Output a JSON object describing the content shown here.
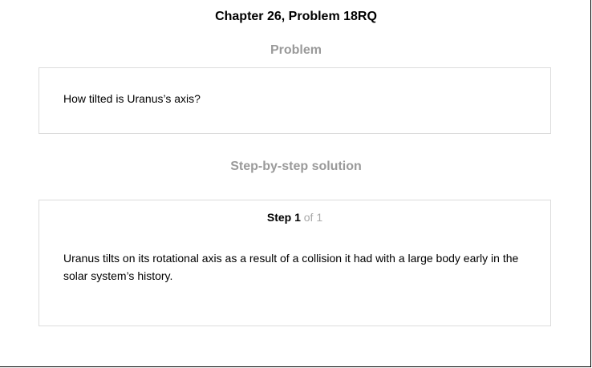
{
  "header": {
    "title": "Chapter 26, Problem 18RQ"
  },
  "problem": {
    "heading": "Problem",
    "text": "How tilted is Uranus’s axis?"
  },
  "solution": {
    "heading": "Step-by-step solution",
    "step_label": "Step 1",
    "step_of": "of 1",
    "text": "Uranus tilts on its rotational axis as a result of a collision it had with a large body early in the solar system’s history."
  }
}
